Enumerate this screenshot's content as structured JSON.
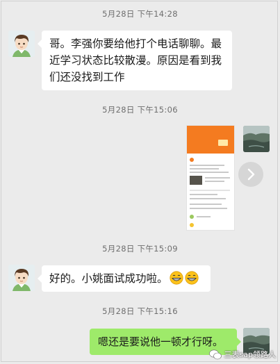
{
  "messages": {
    "ts1": "5月28日 下午14:28",
    "msg1": "哥。李强你要给他打个电话聊聊。最近学习状态比较散漫。原因是看到我们还没找到工作",
    "ts2": "5月28日 下午15:06",
    "ts3": "5月28日 下午15:09",
    "msg3": "好的。小姚面试成功啦。",
    "ts4": "5月28日 下午15:16",
    "msg4": "嗯还是要说他一顿才行呀。"
  },
  "watermark": {
    "text": "三表sap领路人"
  },
  "icons": [
    "avatar-boy-icon",
    "avatar-landscape-icon",
    "forward-arrow-icon",
    "grin-emoji-icon",
    "wechat-icon"
  ],
  "colors": {
    "background": "#ebebeb",
    "bubble_self": "#9eea6a",
    "bubble_other": "#ffffff",
    "timestamp": "#6e6e6e"
  }
}
